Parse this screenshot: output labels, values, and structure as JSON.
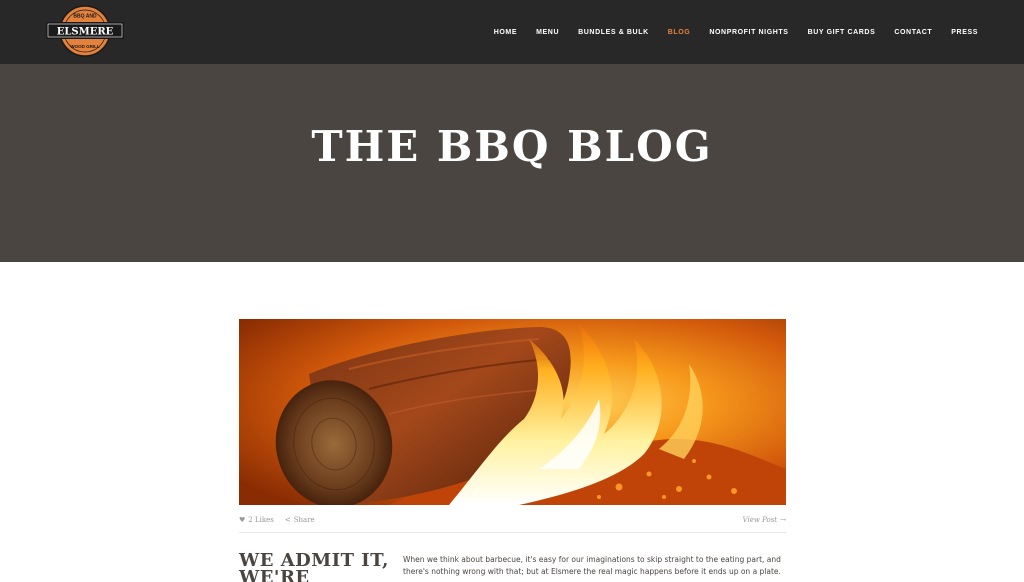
{
  "brand": {
    "name": "ELSMERE",
    "top_text": "BBQ AND",
    "bottom_text": "WOOD GRILL",
    "colors": {
      "orange": "#e4813b",
      "dark": "#282828"
    }
  },
  "nav": {
    "items": [
      {
        "label": "HOME"
      },
      {
        "label": "MENU"
      },
      {
        "label": "BUNDLES & BULK"
      },
      {
        "label": "BLOG"
      },
      {
        "label": "NONPROFIT NIGHTS"
      },
      {
        "label": "BUY GIFT CARDS"
      },
      {
        "label": "CONTACT"
      },
      {
        "label": "PRESS"
      }
    ],
    "active": "BLOG",
    "active_color": "#e4813b"
  },
  "hero": {
    "title": "THE BBQ BLOG",
    "background": "#4a4541"
  },
  "post": {
    "image_icon": "burning-log-image",
    "likes_label": "2 Likes",
    "share_label": "Share",
    "view_post_label": "View Post",
    "title": "WE ADMIT IT, WE'RE",
    "excerpt": "When we think about barbecue, it's easy for our imaginations to skip straight to the eating part, and there's nothing wrong with that; but at Elsmere the real magic happens before it ends up on a plate."
  }
}
